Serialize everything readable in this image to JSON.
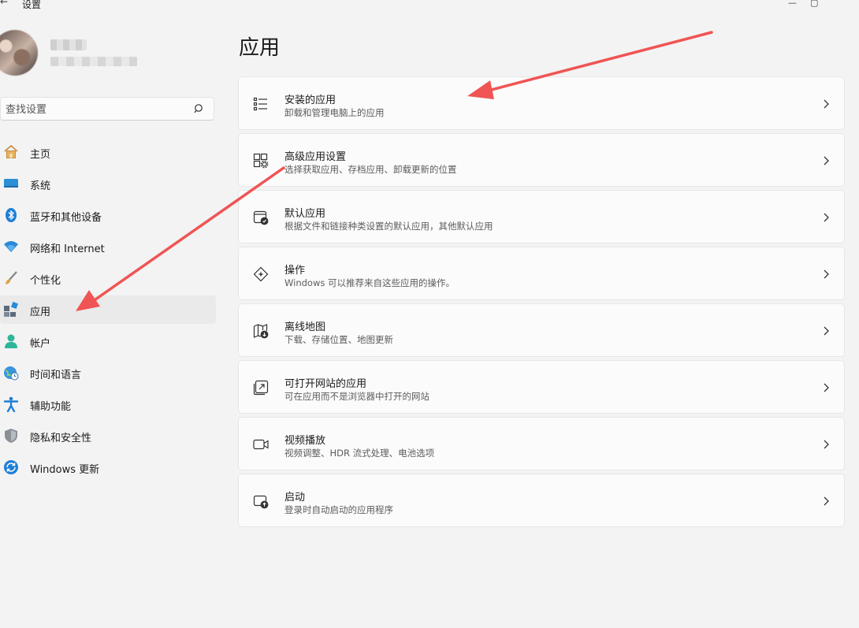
{
  "window": {
    "title": "设置"
  },
  "search": {
    "placeholder": "查找设置"
  },
  "nav": {
    "items": [
      {
        "label": "主页",
        "icon": "home-icon"
      },
      {
        "label": "系统",
        "icon": "display-icon"
      },
      {
        "label": "蓝牙和其他设备",
        "icon": "bluetooth-icon"
      },
      {
        "label": "网络和 Internet",
        "icon": "wifi-icon"
      },
      {
        "label": "个性化",
        "icon": "brush-icon"
      },
      {
        "label": "应用",
        "icon": "apps-icon",
        "active": true
      },
      {
        "label": "帐户",
        "icon": "account-icon"
      },
      {
        "label": "时间和语言",
        "icon": "globe-clock-icon"
      },
      {
        "label": "辅助功能",
        "icon": "accessibility-icon"
      },
      {
        "label": "隐私和安全性",
        "icon": "shield-icon"
      },
      {
        "label": "Windows 更新",
        "icon": "sync-icon"
      }
    ]
  },
  "main": {
    "title": "应用",
    "cards": [
      {
        "title": "安装的应用",
        "desc": "卸载和管理电脑上的应用",
        "icon": "list-icon"
      },
      {
        "title": "高级应用设置",
        "desc": "选择获取应用、存档应用、卸载更新的位置",
        "icon": "app-settings-icon"
      },
      {
        "title": "默认应用",
        "desc": "根据文件和链接种类设置的默认应用，其他默认应用",
        "icon": "default-app-icon"
      },
      {
        "title": "操作",
        "desc": "Windows 可以推荐来自这些应用的操作。",
        "icon": "actions-icon"
      },
      {
        "title": "离线地图",
        "desc": "下载、存储位置、地图更新",
        "icon": "offline-map-icon"
      },
      {
        "title": "可打开网站的应用",
        "desc": "可在应用而不是浏览器中打开的网站",
        "icon": "open-link-icon"
      },
      {
        "title": "视频播放",
        "desc": "视频调整、HDR 流式处理、电池选项",
        "icon": "video-icon"
      },
      {
        "title": "启动",
        "desc": "登录时自动启动的应用程序",
        "icon": "startup-icon"
      }
    ]
  },
  "colors": {
    "accent": "#0067c0",
    "annotation": "#f05454",
    "background": "#f3f3f3"
  }
}
